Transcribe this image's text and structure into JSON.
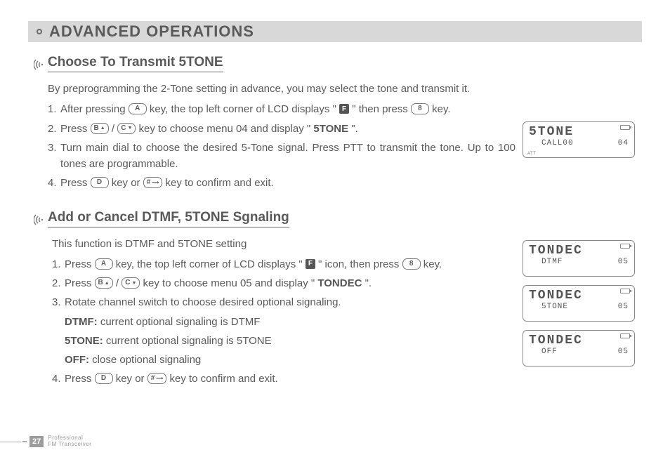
{
  "header": {
    "title": "ADVANCED OPERATIONS"
  },
  "keys": {
    "A": "A",
    "B": "B",
    "C": "C",
    "D": "D",
    "eight": "8",
    "hash": "#",
    "F": "F"
  },
  "section1": {
    "title": "Choose To Transmit 5TONE",
    "intro": "By preprogramming the 2-Tone setting in advance, you may select the tone and transmit it.",
    "n1": "1.",
    "s1a": "After pressing ",
    "s1b": " key, the top left corner of LCD displays \"",
    "s1c": "\" then press ",
    "s1d": " key.",
    "n2": "2.",
    "s2a": "Press ",
    "s2b": " / ",
    "s2c": " key to choose menu 04 and display \"",
    "s2bold": "5TONE",
    "s2d": " \".",
    "n3": "3.",
    "s3a": "Turn main dial to choose the desired 5-Tone signal. Press PTT to transmit the tone. Up to 100 tones are programmable.",
    "n4": "4.",
    "s4a": "Press ",
    "s4b": " key or  ",
    "s4c": " key to confirm and exit.",
    "lcd": {
      "line1": "5TONE",
      "line2a": "CALL00",
      "line2b": "04",
      "att": "ATT"
    }
  },
  "section2": {
    "title": "Add or Cancel DTMF, 5TONE Sgnaling",
    "intro": "This function is DTMF and 5TONE setting",
    "n1": "1.",
    "s1a": "Press ",
    "s1b": " key, the top left corner of LCD displays \"",
    "s1c": "\" icon, then press  ",
    "s1d": " key.",
    "n2": "2.",
    "s2a": "Press ",
    "s2b": " / ",
    "s2c": " key to choose menu 05 and display \"",
    "s2bold": "TONDEC",
    "s2d": "\".",
    "n3": "3.",
    "s3a": "Rotate channel switch to choose desired optional signaling.",
    "opt1b": "DTMF:",
    "opt1": " current optional signaling is DTMF",
    "opt2b": "5TONE:",
    "opt2": " current optional signaling is 5TONE",
    "opt3b": "OFF:",
    "opt3": " close optional signaling",
    "n4": "4.",
    "s4a": "Press ",
    "s4b": " key or ",
    "s4c": " key to confirm and exit.",
    "lcd1": {
      "line1": "TONDEC",
      "line2a": "DTMF",
      "line2b": "05"
    },
    "lcd2": {
      "line1": "TONDEC",
      "line2a": "5TONE",
      "line2b": "05"
    },
    "lcd3": {
      "line1": "TONDEC",
      "line2a": "OFF",
      "line2b": "05"
    }
  },
  "footer": {
    "page": "27",
    "line1": "Professional",
    "line2": "FM Transceiver"
  }
}
